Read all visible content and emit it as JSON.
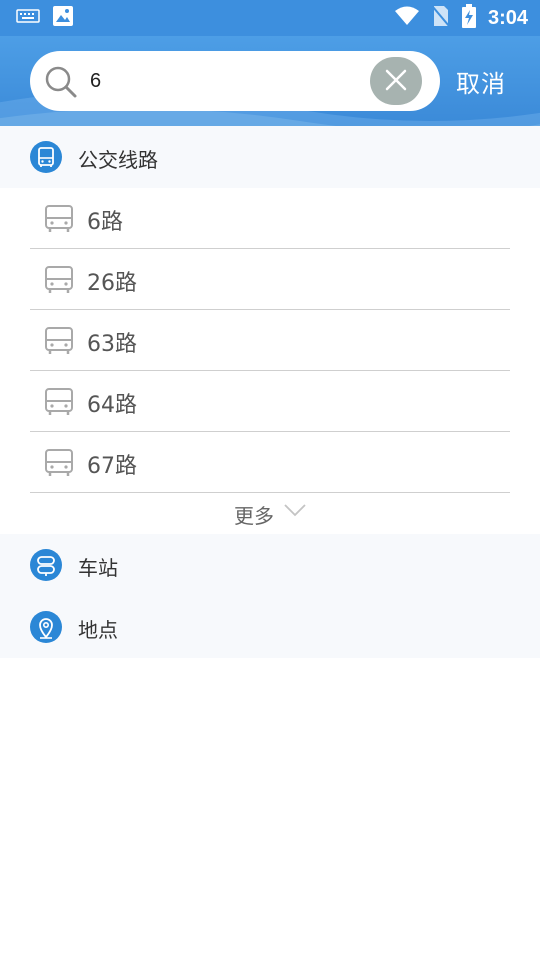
{
  "status_bar": {
    "time": "3:04",
    "left_icons": [
      "keyboard-icon",
      "image-icon"
    ],
    "right_icons": [
      "wifi-icon",
      "no-sim-icon",
      "battery-charging-icon"
    ]
  },
  "search": {
    "value": "6",
    "placeholder": "",
    "clear_icon": "close-icon",
    "cancel_label": "取消"
  },
  "sections": {
    "routes": {
      "label": "公交线路",
      "icon": "bus-icon"
    },
    "stations": {
      "label": "车站",
      "icon": "station-icon"
    },
    "places": {
      "label": "地点",
      "icon": "location-pin-icon"
    }
  },
  "routes": [
    {
      "label": "6路"
    },
    {
      "label": "26路"
    },
    {
      "label": "63路"
    },
    {
      "label": "64路"
    },
    {
      "label": "67路"
    }
  ],
  "more": {
    "label": "更多",
    "icon": "chevron-down-icon"
  },
  "colors": {
    "header": "#3d8fde",
    "section_icon": "#2b87d6",
    "clear_button": "#a7b3b0"
  }
}
